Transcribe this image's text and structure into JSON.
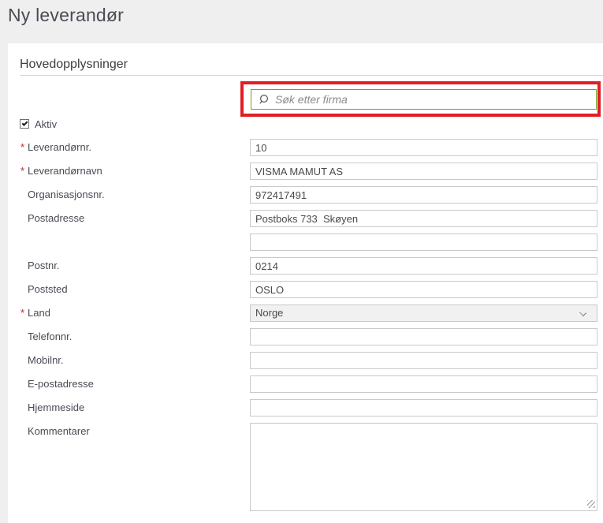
{
  "page": {
    "title": "Ny leverandør"
  },
  "section": {
    "title": "Hovedopplysninger"
  },
  "search": {
    "placeholder": "Søk etter firma",
    "icon": "magnifier"
  },
  "colors": {
    "highlight_red": "#e01e24",
    "search_border_green": "#76a021",
    "required_red": "#cc2128",
    "panel_bg": "#ffffff",
    "page_bg": "#f0eff0"
  },
  "form": {
    "active_checkbox": {
      "label": "Aktiv",
      "checked": true
    },
    "rows": [
      {
        "label": "Leverandørnr.",
        "marker": "*",
        "value": "10"
      },
      {
        "label": "Leverandørnavn",
        "marker": "*",
        "value": "VISMA MAMUT AS"
      },
      {
        "label": "Organisasjonsnr.",
        "marker": "",
        "value": "972417491"
      },
      {
        "label": "Postadresse",
        "marker": "",
        "value": "Postboks 733  Skøyen"
      },
      {
        "label": "",
        "marker": "",
        "value": ""
      },
      {
        "label": "Postnr.",
        "marker": "",
        "value": "0214"
      },
      {
        "label": "Poststed",
        "marker": "",
        "value": "OSLO"
      },
      {
        "label": "Land",
        "marker": "*",
        "value": "Norge",
        "type": "select"
      },
      {
        "label": "Telefonnr.",
        "marker": "",
        "value": ""
      },
      {
        "label": "Mobilnr.",
        "marker": "",
        "value": ""
      },
      {
        "label": "E-postadresse",
        "marker": "",
        "value": ""
      },
      {
        "label": "Hjemmeside",
        "marker": "",
        "value": ""
      },
      {
        "label": "Kommentarer",
        "marker": "",
        "value": "",
        "type": "textarea"
      }
    ]
  }
}
